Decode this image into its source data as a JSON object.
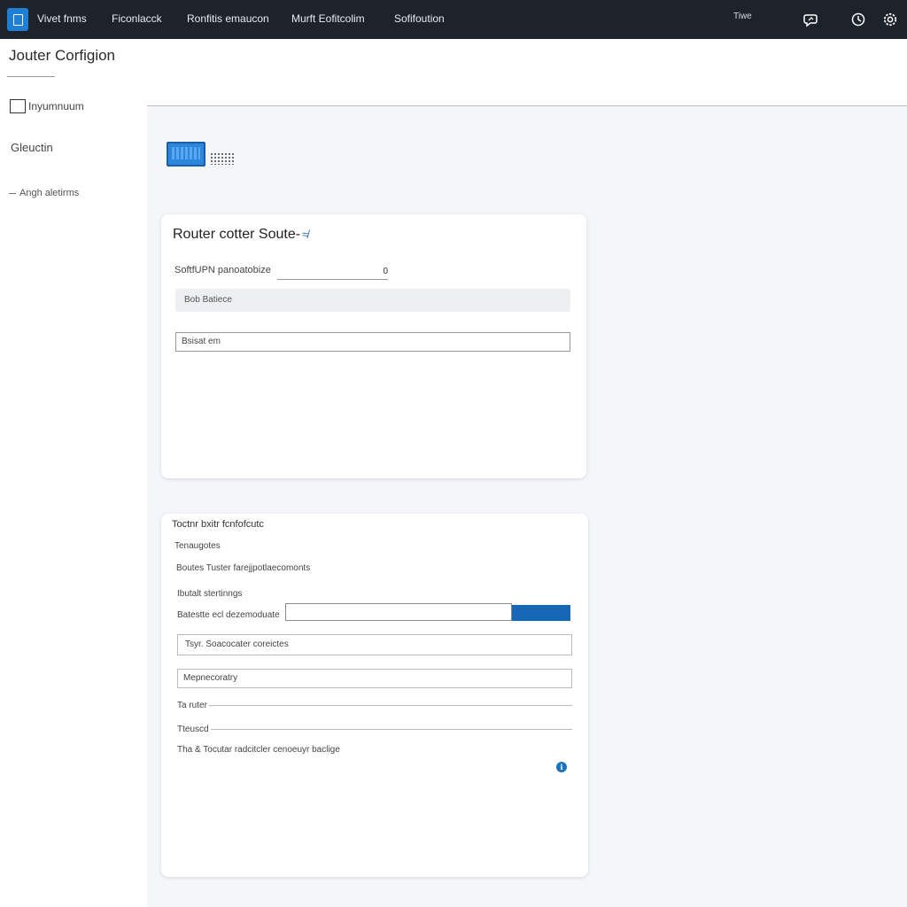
{
  "topbar": {
    "nav": [
      "Vivet fnms",
      "Ficonlacck",
      "Ronfitis emaucon",
      "Murft Eofitcolim",
      "Sofifoution"
    ],
    "extra_text": "Tiwe",
    "icons": [
      "message-icon",
      "clock-icon",
      "settings-icon"
    ]
  },
  "page": {
    "title": "Jouter Corfigion"
  },
  "sidebar": {
    "checkbox_label": "Inyumnuum",
    "item": "Gleuctin",
    "subitem": "Angh aletirms"
  },
  "card1": {
    "title": "Router cotter Soute-",
    "title_icon": "≉",
    "field_label": "SoftfUPN panoatobize",
    "field_value": "0",
    "bar_text": "Bob Batiece",
    "input_value": "Bsisat em"
  },
  "card2": {
    "heading": "Toctnr bxitr fcnfofcutc",
    "sub1": "Tenaugotes",
    "sub2": "Boutes Tuster farejjpotlaecomonts",
    "sub3": "Ibutalt stertinngs",
    "inline_label": "Batestte ecl dezemoduate",
    "box1_value": "Tsyr.   Soacocater coreictes",
    "box2_value": "Mepnecoratry",
    "row1_label": "Ta ruter",
    "row2_label": "Tteuscd",
    "footer": "Tha & Tocutar radcitcler cenoeuyr baclige",
    "info_icon_glyph": "i"
  },
  "colors": {
    "topbar": "#1e222b",
    "accent": "#1f7fd4",
    "button": "#1667b8",
    "content_bg": "#f4f6f9"
  }
}
